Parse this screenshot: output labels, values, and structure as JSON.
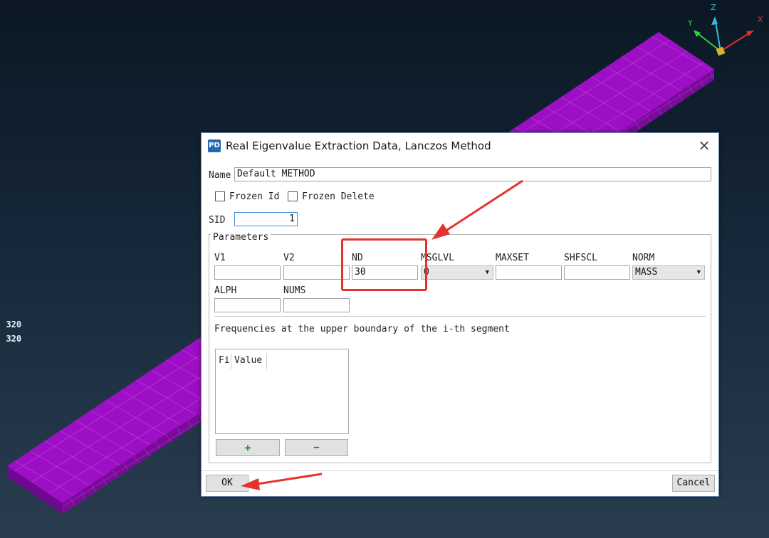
{
  "stats": [
    "  :     320",
    "  :     320"
  ],
  "axes": {
    "x": "X",
    "y": "Y",
    "z": "Z"
  },
  "colors": {
    "model": "#9c0fc4",
    "mesh_line": "#c84ae0",
    "highlight": "#e5322d",
    "accent": "#3d8ed6"
  },
  "dialog": {
    "icon_text": "PD",
    "title": "Real Eigenvalue Extraction Data, Lanczos Method",
    "close": "×",
    "name_label": "Name",
    "name_value": "Default METHOD",
    "frozen_id_label": "Frozen Id",
    "frozen_delete_label": "Frozen Delete",
    "sid_label": "SID",
    "sid_value": "1",
    "parameters_label": "Parameters",
    "params": {
      "v1_label": "V1",
      "v1_value": "",
      "v2_label": "V2",
      "v2_value": "",
      "nd_label": "ND",
      "nd_value": "30",
      "msglvl_label": "MSGLVL",
      "msglvl_value": "0",
      "maxset_label": "MAXSET",
      "maxset_value": "",
      "shfscl_label": "SHFSCL",
      "shfscl_value": "",
      "norm_label": "NORM",
      "norm_value": "MASS",
      "alph_label": "ALPH",
      "alph_value": "",
      "nums_label": "NUMS",
      "nums_value": ""
    },
    "freq_label": "Frequencies at the upper boundary of the i-th segment",
    "table": {
      "col_fi": "Fi",
      "col_value": "Value"
    },
    "add_symbol": "+",
    "remove_symbol": "−",
    "ok": "OK",
    "cancel": "Cancel"
  }
}
